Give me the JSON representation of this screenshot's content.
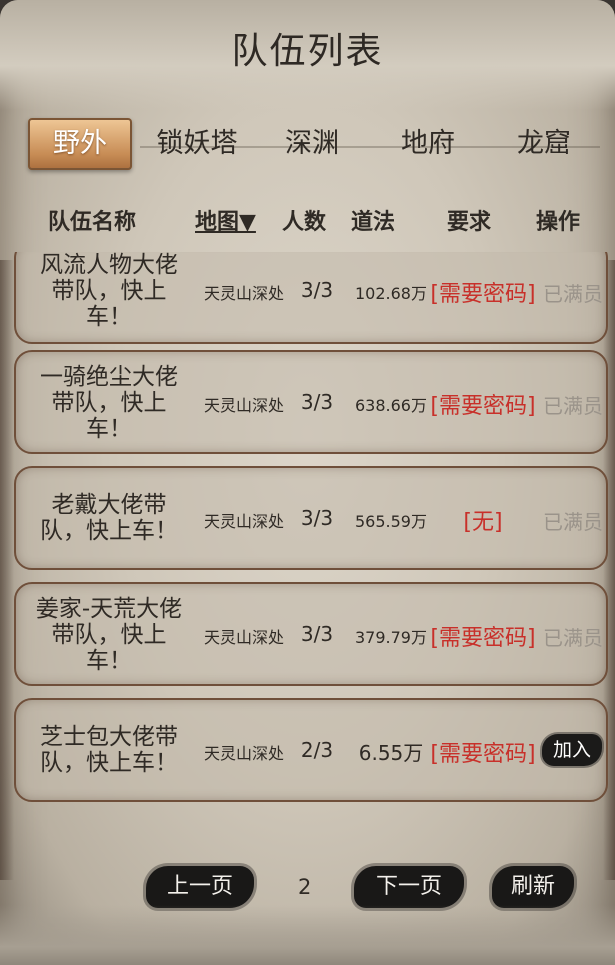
{
  "title": "队伍列表",
  "tabs": [
    {
      "label": "野外",
      "active": true
    },
    {
      "label": "锁妖塔",
      "active": false
    },
    {
      "label": "深渊",
      "active": false
    },
    {
      "label": "地府",
      "active": false
    },
    {
      "label": "龙窟",
      "active": false
    }
  ],
  "columns": {
    "name": "队伍名称",
    "map": "地图▼",
    "count": "人数",
    "power": "道法",
    "requirement": "要求",
    "action": "操作"
  },
  "rows": [
    {
      "name_lines": [
        "风流人物大佬",
        "带队，快上",
        "车！"
      ],
      "map": "天灵山深处",
      "count": "3/3",
      "power": "102.68万",
      "requirement": "[需要密码]",
      "action": "已满员"
    },
    {
      "name_lines": [
        "一骑绝尘大佬",
        "带队，快上",
        "车！"
      ],
      "map": "天灵山深处",
      "count": "3/3",
      "power": "638.66万",
      "requirement": "[需要密码]",
      "action": "已满员"
    },
    {
      "name_lines": [
        "老戴大佬带",
        "队，快上车！"
      ],
      "map": "天灵山深处",
      "count": "3/3",
      "power": "565.59万",
      "requirement": "[无]",
      "action": "已满员"
    },
    {
      "name_lines": [
        "姜家-天荒大佬",
        "带队，快上",
        "车！"
      ],
      "map": "天灵山深处",
      "count": "3/3",
      "power": "379.79万",
      "requirement": "[需要密码]",
      "action": "已满员"
    },
    {
      "name_lines": [
        "芝士包大佬带",
        "队，快上车！"
      ],
      "map": "天灵山深处",
      "count": "2/3",
      "power": "6.55万",
      "requirement": "[需要密码]",
      "action": "加入"
    }
  ],
  "footer": {
    "prev_label": "上一页",
    "page": "2",
    "next_label": "下一页",
    "refresh_label": "刷新"
  }
}
